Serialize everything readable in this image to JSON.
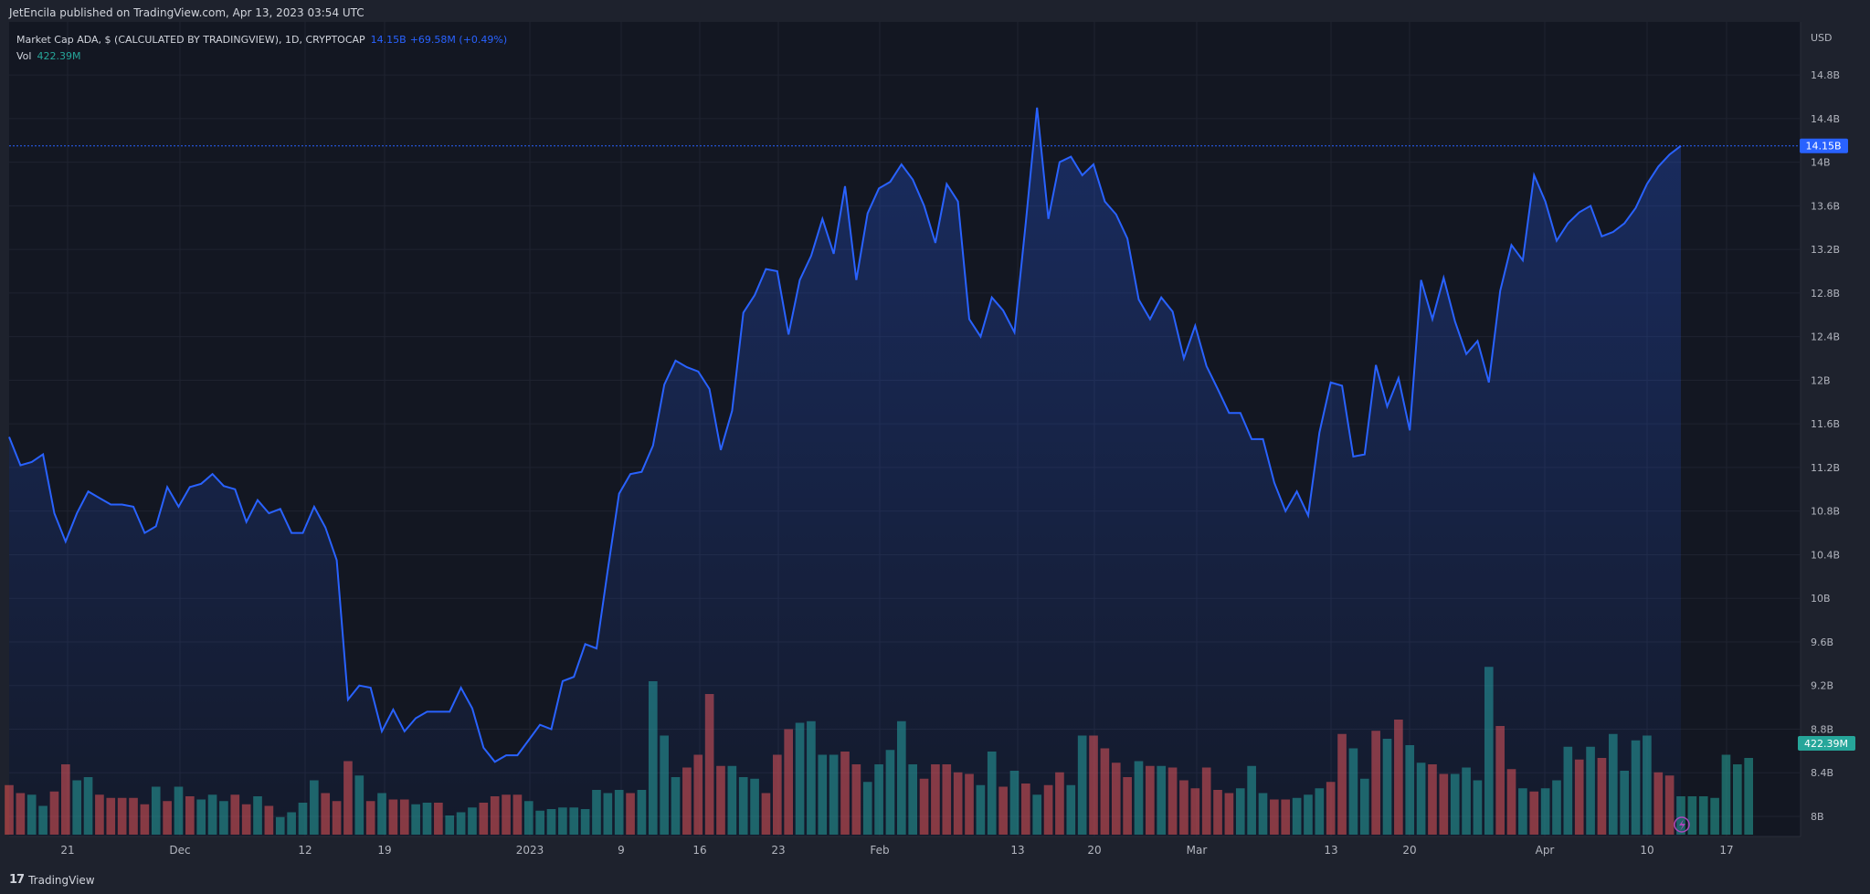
{
  "header": {
    "publisher": "JetEncila published on TradingView.com, Apr 13, 2023 03:54 UTC"
  },
  "legend": {
    "symbol": "Market Cap ADA, $ (CALCULATED BY TRADINGVIEW), 1D, CRYPTOCAP",
    "last": "14.15B",
    "change": "+69.58M (+0.49%)",
    "vol_label": "Vol",
    "vol_value": "422.39M"
  },
  "footer": {
    "brand": "TradingView"
  },
  "colors": {
    "background": "#131722",
    "line": "#2962ff",
    "up": "#26a69a",
    "down": "#ef5350",
    "grid": "#2a2e39",
    "text": "#b2b5be"
  },
  "chart_data": {
    "type": "line",
    "y_axis_unit": "USD",
    "y_ticks": [
      "14.8B",
      "14.4B",
      "14B",
      "13.6B",
      "13.2B",
      "12.8B",
      "12.4B",
      "12B",
      "11.6B",
      "11.2B",
      "10.8B",
      "10.4B",
      "10B",
      "9.6B",
      "9.2B",
      "8.8B",
      "8.4B",
      "8B"
    ],
    "y_tick_values": [
      14.8,
      14.4,
      14.0,
      13.6,
      13.2,
      12.8,
      12.4,
      12.0,
      11.6,
      11.2,
      10.8,
      10.4,
      10.0,
      9.6,
      9.2,
      8.8,
      8.4,
      8.0
    ],
    "x_ticks": [
      "21",
      "Dec",
      "12",
      "19",
      "2023",
      "9",
      "16",
      "23",
      "Feb",
      "13",
      "20",
      "Mar",
      "13",
      "20",
      "Apr",
      "10",
      "17"
    ],
    "price_label": "14.15B",
    "volume_label": "422.39M",
    "series": [
      {
        "values": [
          11.48,
          11.22,
          11.25,
          11.32,
          10.78,
          10.52,
          10.78,
          10.98,
          10.92,
          10.86,
          10.86,
          10.84,
          10.6,
          10.66,
          11.02,
          10.84,
          11.02,
          11.05,
          11.14,
          11.03,
          11.0,
          10.7,
          10.9,
          10.78,
          10.82,
          10.6,
          10.6,
          10.84,
          10.65,
          10.35,
          9.07,
          9.2,
          9.18,
          8.78,
          8.98,
          8.78,
          8.9,
          8.96,
          8.96,
          8.96,
          9.18,
          8.99,
          8.63,
          8.5,
          8.56,
          8.56,
          8.7,
          8.84,
          8.8,
          9.24,
          9.28,
          9.58,
          9.54,
          10.26,
          10.96,
          11.14,
          11.16,
          11.4,
          11.96,
          12.18,
          12.12,
          12.08,
          11.92,
          11.36,
          11.72,
          12.62,
          12.78,
          13.02,
          13.0,
          12.42,
          12.92,
          13.14,
          13.48,
          13.16,
          13.78,
          12.92,
          13.53,
          13.76,
          13.82,
          13.98,
          13.84,
          13.6,
          13.26,
          13.8,
          13.64,
          12.56,
          12.4,
          12.76,
          12.64,
          12.44,
          13.44,
          14.5,
          13.48,
          14.0,
          14.05,
          13.88,
          13.98,
          13.64,
          13.52,
          13.3,
          12.74,
          12.56,
          12.76,
          12.63,
          12.2,
          12.5,
          12.13,
          11.92,
          11.7,
          11.7,
          11.46,
          11.46,
          11.06,
          10.8,
          10.98,
          10.76,
          11.52,
          11.98,
          11.95,
          11.3,
          11.32,
          12.14,
          11.76,
          12.02,
          11.54,
          12.92,
          12.56,
          12.94,
          12.54,
          12.24,
          12.36,
          11.98,
          12.82,
          13.24,
          13.1,
          13.88,
          13.64,
          13.28,
          13.44,
          13.54,
          13.6,
          13.32,
          13.36,
          13.44,
          13.58,
          13.8,
          13.96,
          14.07,
          14.15
        ]
      },
      {
        "name": "Vol",
        "volume_scale": [
          0,
          1
        ],
        "volume_pct": [
          0.31,
          0.26,
          0.25,
          0.18,
          0.27,
          0.44,
          0.34,
          0.36,
          0.25,
          0.23,
          0.23,
          0.23,
          0.19,
          0.3,
          0.21,
          0.3,
          0.24,
          0.22,
          0.25,
          0.21,
          0.25,
          0.19,
          0.24,
          0.18,
          0.11,
          0.14,
          0.2,
          0.34,
          0.26,
          0.21,
          0.46,
          0.37,
          0.21,
          0.26,
          0.22,
          0.22,
          0.19,
          0.2,
          0.2,
          0.12,
          0.14,
          0.17,
          0.2,
          0.24,
          0.25,
          0.25,
          0.21,
          0.15,
          0.16,
          0.17,
          0.17,
          0.16,
          0.28,
          0.26,
          0.28,
          0.26,
          0.28,
          0.96,
          0.62,
          0.36,
          0.42,
          0.5,
          0.88,
          0.43,
          0.43,
          0.36,
          0.35,
          0.26,
          0.5,
          0.66,
          0.7,
          0.71,
          0.5,
          0.5,
          0.52,
          0.44,
          0.33,
          0.44,
          0.53,
          0.71,
          0.44,
          0.35,
          0.44,
          0.44,
          0.39,
          0.38,
          0.31,
          0.52,
          0.3,
          0.4,
          0.32,
          0.25,
          0.31,
          0.39,
          0.31,
          0.62,
          0.62,
          0.54,
          0.45,
          0.36,
          0.46,
          0.43,
          0.43,
          0.42,
          0.34,
          0.29,
          0.42,
          0.28,
          0.26,
          0.29,
          0.43,
          0.26,
          0.22,
          0.22,
          0.23,
          0.25,
          0.29,
          0.33,
          0.63,
          0.54,
          0.35,
          0.65,
          0.6,
          0.72,
          0.56,
          0.45,
          0.44,
          0.38,
          0.38,
          0.42,
          0.34,
          1.05,
          0.68,
          0.41,
          0.29,
          0.27,
          0.29,
          0.34,
          0.55,
          0.47,
          0.55,
          0.48,
          0.63,
          0.4,
          0.59,
          0.62,
          0.39,
          0.37,
          0.24,
          0.24,
          0.24,
          0.23,
          0.5,
          0.44,
          0.48
        ],
        "volume_up": [
          0,
          0,
          1,
          1,
          0,
          0,
          1,
          1,
          0,
          0,
          0,
          0,
          0,
          1,
          0,
          1,
          0,
          1,
          1,
          1,
          0,
          0,
          1,
          0,
          1,
          1,
          1,
          1,
          0,
          0,
          0,
          1,
          0,
          1,
          0,
          0,
          1,
          1,
          0,
          1,
          1,
          1,
          0,
          0,
          0,
          0,
          1,
          1,
          1,
          1,
          1,
          1,
          1,
          1,
          1,
          0,
          1,
          1,
          1,
          1,
          0,
          0,
          0,
          0,
          1,
          1,
          1,
          0,
          0,
          0,
          1,
          1,
          1,
          1,
          0,
          0,
          1,
          1,
          1,
          1,
          1,
          0,
          0,
          0,
          0,
          0,
          1,
          1,
          0,
          1,
          0,
          1,
          0,
          0,
          1,
          1,
          0,
          0,
          0,
          0,
          1,
          0,
          1,
          0,
          0,
          0,
          0,
          0,
          0,
          1,
          1,
          1,
          0,
          0,
          1,
          1,
          1,
          0,
          0,
          1,
          1,
          0,
          1,
          0,
          1,
          1,
          0,
          0,
          1,
          1,
          1,
          1,
          0,
          0,
          1,
          0,
          1,
          1,
          1,
          0,
          1,
          0,
          1,
          1,
          1,
          1,
          0,
          0,
          1,
          1,
          1,
          1,
          1,
          1,
          1
        ]
      }
    ]
  }
}
